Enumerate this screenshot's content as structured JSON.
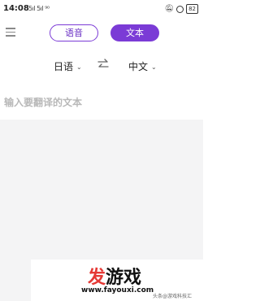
{
  "status_bar": {
    "time": "14:08",
    "signal_text": "5ıl 5ıl ⁹⁰",
    "battery": "82"
  },
  "header": {
    "tabs": [
      {
        "label": "语音",
        "active": false
      },
      {
        "label": "文本",
        "active": true
      }
    ]
  },
  "language": {
    "source": "日语",
    "target": "中文"
  },
  "input": {
    "placeholder": "输入要翻译的文本"
  },
  "watermark": {
    "logo_char1": "发",
    "logo_rest": "游戏",
    "url": "www.fayouxi.com",
    "small_text": "头条@游戏科技汇"
  },
  "colors": {
    "accent": "#7b3bd6",
    "placeholder": "#b8b8b8",
    "panel_bg": "#f4f4f5",
    "logo_red": "#e53935"
  },
  "icons": [
    "menu-icon",
    "swap-icon",
    "chevron-down-icon",
    "bell-off-icon",
    "alarm-icon",
    "battery-icon"
  ]
}
